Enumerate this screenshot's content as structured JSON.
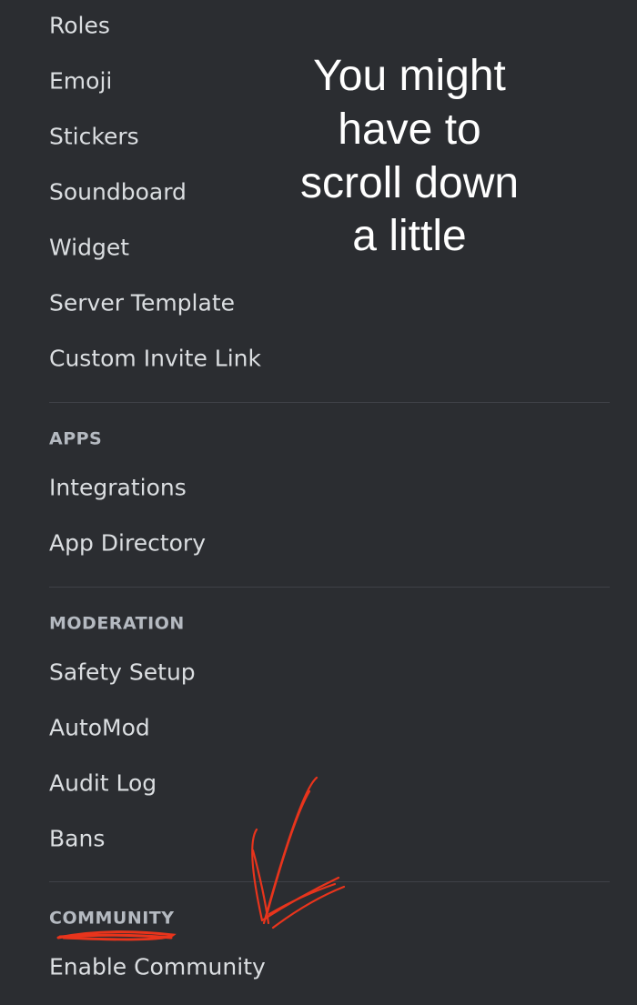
{
  "menu": {
    "general_items": [
      "Roles",
      "Emoji",
      "Stickers",
      "Soundboard",
      "Widget",
      "Server Template",
      "Custom Invite Link"
    ],
    "apps": {
      "header": "APPS",
      "items": [
        "Integrations",
        "App Directory"
      ]
    },
    "moderation": {
      "header": "MODERATION",
      "items": [
        "Safety Setup",
        "AutoMod",
        "Audit Log",
        "Bans"
      ]
    },
    "community": {
      "header": "COMMUNITY",
      "items": [
        "Enable Community"
      ]
    }
  },
  "annotation": {
    "lines": [
      "You might",
      "have to",
      "scroll down",
      "a little"
    ],
    "ink_color": "#e8341c"
  },
  "colors": {
    "background": "#2b2d31",
    "item_text": "#dbdee1",
    "header_text": "#b5bac1"
  }
}
